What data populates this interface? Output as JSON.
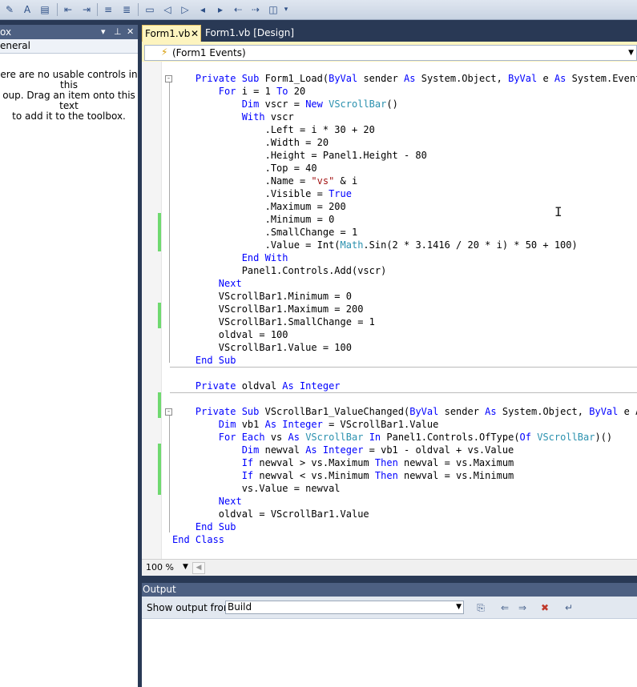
{
  "toolbox": {
    "title": "ox",
    "group": "eneral",
    "message": [
      "ere are no usable controls in this",
      "oup. Drag an item onto this text",
      "to add it to the toolbox."
    ]
  },
  "tabs": [
    {
      "label": "Form1.vb",
      "active": true
    },
    {
      "label": "Form1.vb [Design]",
      "active": false
    }
  ],
  "events_dropdown": "(Form1 Events)",
  "code_lines": [
    [
      [
        "    ",
        ""
      ],
      [
        "Private Sub ",
        "kw"
      ],
      [
        "Form1_Load(",
        ""
      ],
      [
        "ByVal ",
        "kw"
      ],
      [
        "sender ",
        ""
      ],
      [
        "As ",
        "kw"
      ],
      [
        "System.",
        ""
      ],
      [
        "Object",
        ""
      ],
      [
        ", ",
        ""
      ],
      [
        "ByVal ",
        "kw"
      ],
      [
        "e ",
        ""
      ],
      [
        "As ",
        "kw"
      ],
      [
        "System.",
        ""
      ],
      [
        "EventArgs",
        ""
      ]
    ],
    [
      [
        "        ",
        ""
      ],
      [
        "For ",
        "kw"
      ],
      [
        "i = 1 ",
        ""
      ],
      [
        "To ",
        "kw"
      ],
      [
        "20",
        ""
      ]
    ],
    [
      [
        "            ",
        ""
      ],
      [
        "Dim ",
        "kw"
      ],
      [
        "vscr = ",
        ""
      ],
      [
        "New ",
        "kw"
      ],
      [
        "VScrollBar",
        "ty"
      ],
      [
        "()",
        ""
      ]
    ],
    [
      [
        "            ",
        ""
      ],
      [
        "With ",
        "kw"
      ],
      [
        "vscr",
        ""
      ]
    ],
    [
      [
        "                .Left = i * 30 + 20",
        ""
      ]
    ],
    [
      [
        "                .Width = 20",
        ""
      ]
    ],
    [
      [
        "                .Height = Panel1.Height - 80",
        ""
      ]
    ],
    [
      [
        "                .Top = 40",
        ""
      ]
    ],
    [
      [
        "                .Name = ",
        ""
      ],
      [
        "\"vs\"",
        "st"
      ],
      [
        " & i",
        ""
      ]
    ],
    [
      [
        "                .Visible = ",
        ""
      ],
      [
        "True",
        "kw"
      ]
    ],
    [
      [
        "                .Maximum = 200",
        ""
      ]
    ],
    [
      [
        "                .Minimum = 0",
        ""
      ]
    ],
    [
      [
        "                .SmallChange = 1",
        ""
      ]
    ],
    [
      [
        "                .Value = Int(",
        ""
      ],
      [
        "Math",
        "ty"
      ],
      [
        ".Sin(2 * 3.1416 / 20 * i) * 50 + 100)",
        ""
      ]
    ],
    [
      [
        "            ",
        ""
      ],
      [
        "End With",
        "kw"
      ]
    ],
    [
      [
        "            Panel1.Controls.Add(vscr)",
        ""
      ]
    ],
    [
      [
        "        ",
        ""
      ],
      [
        "Next",
        "kw"
      ]
    ],
    [
      [
        "        VScrollBar1.Minimum = 0",
        ""
      ]
    ],
    [
      [
        "        VScrollBar1.Maximum = 200",
        ""
      ]
    ],
    [
      [
        "        VScrollBar1.SmallChange = 1",
        ""
      ]
    ],
    [
      [
        "        oldval = 100",
        ""
      ]
    ],
    [
      [
        "        VScrollBar1.Value = 100",
        ""
      ]
    ],
    [
      [
        "    ",
        ""
      ],
      [
        "End Sub",
        "kw"
      ]
    ],
    [
      [
        "",
        ""
      ]
    ],
    [
      [
        "    ",
        ""
      ],
      [
        "Private ",
        "kw"
      ],
      [
        "oldval ",
        ""
      ],
      [
        "As Integer",
        "kw"
      ]
    ],
    [
      [
        "",
        ""
      ]
    ],
    [
      [
        "    ",
        ""
      ],
      [
        "Private Sub ",
        "kw"
      ],
      [
        "VScrollBar1_ValueChanged(",
        ""
      ],
      [
        "ByVal ",
        "kw"
      ],
      [
        "sender ",
        ""
      ],
      [
        "As ",
        "kw"
      ],
      [
        "System.",
        ""
      ],
      [
        "Object",
        ""
      ],
      [
        ", ",
        ""
      ],
      [
        "ByVal ",
        "kw"
      ],
      [
        "e ",
        ""
      ],
      [
        "As",
        ""
      ]
    ],
    [
      [
        "        ",
        ""
      ],
      [
        "Dim ",
        "kw"
      ],
      [
        "vb1 ",
        ""
      ],
      [
        "As Integer",
        "kw"
      ],
      [
        " = VScrollBar1.Value",
        ""
      ]
    ],
    [
      [
        "        ",
        ""
      ],
      [
        "For Each ",
        "kw"
      ],
      [
        "vs ",
        ""
      ],
      [
        "As ",
        "kw"
      ],
      [
        "VScrollBar",
        "ty"
      ],
      [
        " ",
        ""
      ],
      [
        "In ",
        "kw"
      ],
      [
        "Panel1.Controls.OfType(",
        ""
      ],
      [
        "Of ",
        "kw"
      ],
      [
        "VScrollBar",
        "ty"
      ],
      [
        ")()",
        ""
      ]
    ],
    [
      [
        "            ",
        ""
      ],
      [
        "Dim ",
        "kw"
      ],
      [
        "newval ",
        ""
      ],
      [
        "As Integer",
        "kw"
      ],
      [
        " = vb1 - oldval + vs.Value",
        ""
      ]
    ],
    [
      [
        "            ",
        ""
      ],
      [
        "If ",
        "kw"
      ],
      [
        "newval > vs.Maximum ",
        ""
      ],
      [
        "Then ",
        "kw"
      ],
      [
        "newval = vs.Maximum",
        ""
      ]
    ],
    [
      [
        "            ",
        ""
      ],
      [
        "If ",
        "kw"
      ],
      [
        "newval < vs.Minimum ",
        ""
      ],
      [
        "Then ",
        "kw"
      ],
      [
        "newval = vs.Minimum",
        ""
      ]
    ],
    [
      [
        "            vs.Value = newval",
        ""
      ]
    ],
    [
      [
        "        ",
        ""
      ],
      [
        "Next",
        "kw"
      ]
    ],
    [
      [
        "        oldval = VScrollBar1.Value",
        ""
      ]
    ],
    [
      [
        "    ",
        ""
      ],
      [
        "End Sub",
        "kw"
      ]
    ],
    [
      [
        "",
        ""
      ],
      [
        "End Class",
        "kw"
      ]
    ]
  ],
  "zoom": "100 %",
  "output": {
    "title": "Output",
    "show_from_label": "Show output from:",
    "source": "Build"
  },
  "colors": {
    "keyword": "#0000ff",
    "type": "#2b91af",
    "string": "#a31515",
    "tab_active": "#fdf4bf",
    "chrome": "#293955"
  }
}
